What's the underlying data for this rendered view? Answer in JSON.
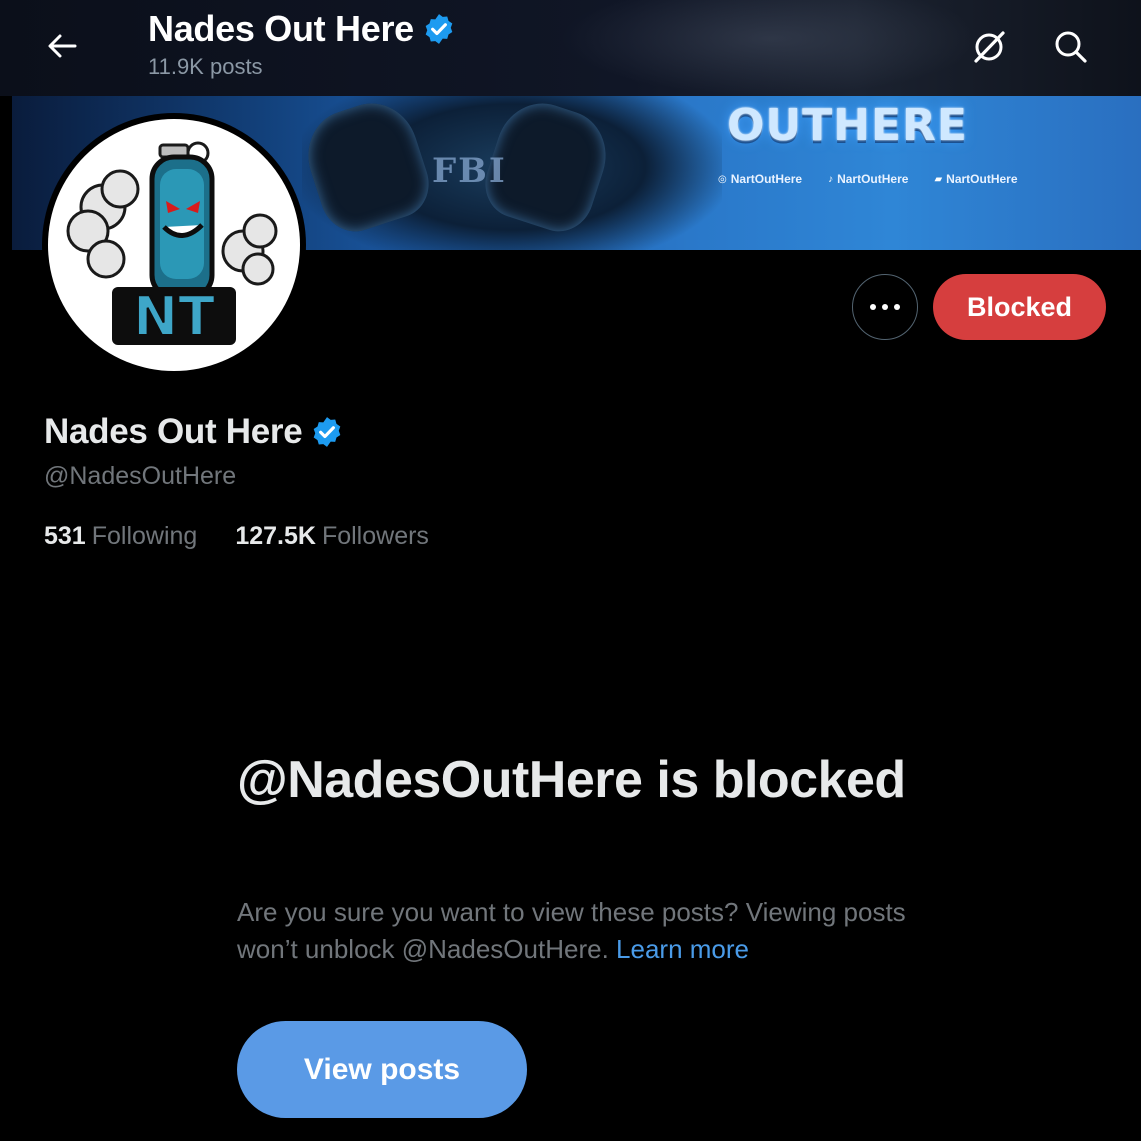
{
  "header": {
    "title": "Nades Out Here",
    "posts_count": "11.9K posts",
    "icons": [
      "back-arrow-icon",
      "verified-badge-icon",
      "grok-icon",
      "search-icon"
    ]
  },
  "banner": {
    "brand_text": "OUTHERE",
    "badge_text": "FBI",
    "socials": [
      {
        "icon": "instagram-icon",
        "label": "NartOutHere"
      },
      {
        "icon": "tiktok-icon",
        "label": "NartOutHere"
      },
      {
        "icon": "kick-icon",
        "label": "NartOutHere"
      }
    ]
  },
  "avatar": {
    "logo_text": "NT"
  },
  "actions": {
    "blocked_label": "Blocked",
    "more_icon": "more-horizontal-icon"
  },
  "profile": {
    "name": "Nades Out Here",
    "handle": "@NadesOutHere",
    "following_count": "531",
    "following_label": "Following",
    "followers_count": "127.5K",
    "followers_label": "Followers"
  },
  "blocked_notice": {
    "title": "@NadesOutHere is blocked",
    "description": "Are you sure you want to view these posts? Viewing posts won’t unblock @NadesOutHere.",
    "learn_more": "Learn more",
    "view_posts_label": "View posts"
  },
  "colors": {
    "background": "#000000",
    "blocked_red": "#d63e3e",
    "link_blue": "#4a9be8",
    "verified_blue": "#1d9bf0",
    "view_button": "#5a9ae6",
    "muted_text": "#71767b"
  }
}
